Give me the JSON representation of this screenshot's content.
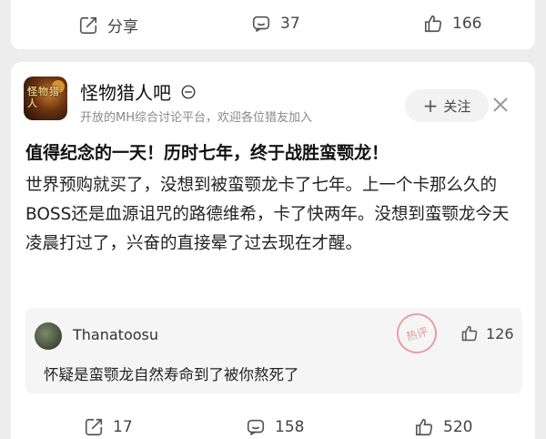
{
  "top_card": {
    "share_label": "分享",
    "comment_count": "37",
    "like_count": "166"
  },
  "post": {
    "forum_name": "怪物猎人吧",
    "forum_description": "开放的MH综合讨论平台，欢迎各位猎友加入",
    "avatar_text": "怪物猎人",
    "follow_label": "关注",
    "title": "值得纪念的一天！历时七年，终于战胜蛮颚龙！",
    "body": "世界预购就买了，没想到被蛮颚龙卡了七年。上一个卡那么久的BOSS还是血源诅咒的路德维希，卡了快两年。没想到蛮颚龙今天凌晨打过了，兴奋的直接晕了过去现在才醒。"
  },
  "comment": {
    "username": "Thanatoosu",
    "stamp_label": "热评",
    "like_count": "126",
    "text": "怀疑是蛮颚龙自然寿命到了被你熬死了"
  },
  "bottom_bar": {
    "share_count": "17",
    "comment_count": "158",
    "like_count": "520"
  },
  "icons": {
    "share": "share-icon",
    "comment": "comment-icon",
    "like": "thumbs-up-icon",
    "close": "close-icon",
    "badge": "no-entry-badge-icon"
  }
}
